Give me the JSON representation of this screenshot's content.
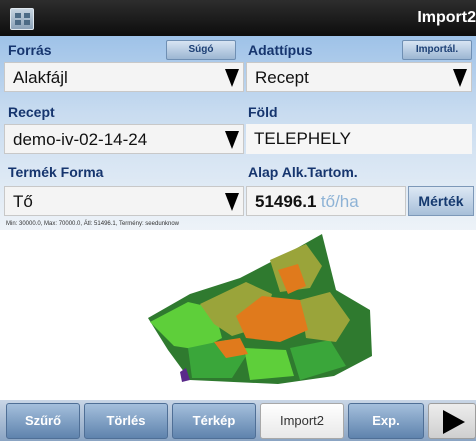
{
  "titlebar": {
    "title": "Import2",
    "icon": "app-grid-icon"
  },
  "form": {
    "source_label": "Forrás",
    "help_button": "Súgó",
    "datatype_label": "Adattípus",
    "import_button": "Importál.",
    "source_value": "Alakfájl",
    "datatype_value": "Recept",
    "recipe_label": "Recept",
    "field_label": "Föld",
    "recipe_value": "demo-iv-02-14-24",
    "field_value": "TELEPHELY",
    "product_form_label": "Termék Forma",
    "base_rate_label": "Alap Alk.Tartom.",
    "product_form_value": "Tő",
    "base_rate_value": "51496.1",
    "base_rate_unit": "tő/ha",
    "measure_button": "Mérték"
  },
  "map": {
    "info": "Min: 30000.0, Max: 70000.0, Átl: 51496.1, Termény: seedunknow",
    "colors": {
      "dark_green": "#2f7a2f",
      "green": "#3aa63a",
      "light_green": "#5ecf3a",
      "olive": "#9aa43a",
      "orange": "#e07a1c",
      "violet": "#5a2a8a"
    }
  },
  "toolbar": {
    "filter": "Szűrő",
    "delete": "Törlés",
    "map": "Térkép",
    "import2": "Import2",
    "export": "Exp.",
    "next_icon": "play-icon"
  }
}
